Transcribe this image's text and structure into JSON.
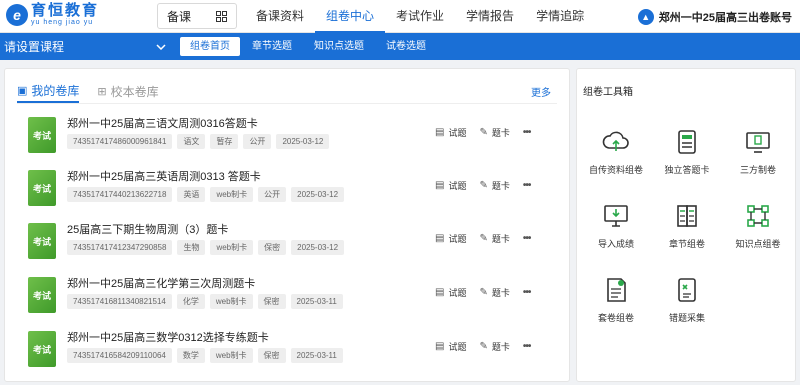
{
  "logo": {
    "cn": "育恒教育",
    "pinyin": "yu heng jiao yu"
  },
  "header": {
    "beike_label": "备课",
    "nav": [
      {
        "label": "备课资料"
      },
      {
        "label": "组卷中心"
      },
      {
        "label": "考试作业"
      },
      {
        "label": "学情报告"
      },
      {
        "label": "学情追踪"
      }
    ],
    "school": "郑州一中25届高三出卷账号"
  },
  "subbar": {
    "course_placeholder": "请设置课程",
    "tabs": [
      {
        "label": "组卷首页"
      },
      {
        "label": "章节选题"
      },
      {
        "label": "知识点选题"
      },
      {
        "label": "试卷选题"
      }
    ]
  },
  "library": {
    "tabs": [
      {
        "label": "我的卷库"
      },
      {
        "label": "校本卷库"
      }
    ],
    "more": "更多",
    "actions": {
      "quiz": "试题",
      "card": "题卡"
    },
    "items": [
      {
        "badge": "考试",
        "title": "郑州一中25届高三语文周测0316答题卡",
        "tags": [
          "743517417486000961841",
          "语文",
          "暂存",
          "公开",
          "2025-03-12"
        ]
      },
      {
        "badge": "考试",
        "title": "郑州一中25届高三英语周测0313 答题卡",
        "tags": [
          "743517417440213622718",
          "英语",
          "web制卡",
          "公开",
          "2025-03-12"
        ]
      },
      {
        "badge": "考试",
        "title": "25届高三下期生物周测（3）题卡",
        "tags": [
          "743517417412347290858",
          "生物",
          "web制卡",
          "保密",
          "2025-03-12"
        ]
      },
      {
        "badge": "考试",
        "title": "郑州一中25届高三化学第三次周测题卡",
        "tags": [
          "743517416811340821514",
          "化学",
          "web制卡",
          "保密",
          "2025-03-11"
        ]
      },
      {
        "badge": "考试",
        "title": "郑州一中25届高三数学0312选择专练题卡",
        "tags": [
          "743517416584209110064",
          "数学",
          "web制卡",
          "保密",
          "2025-03-11"
        ]
      }
    ]
  },
  "toolbox": {
    "title": "组卷工具箱",
    "tools": [
      {
        "label": "自传资料组卷",
        "icon": "cloud-upload-icon"
      },
      {
        "label": "独立答题卡",
        "icon": "answer-card-icon"
      },
      {
        "label": "三方制卷",
        "icon": "monitor-share-icon"
      },
      {
        "label": "导入成绩",
        "icon": "monitor-import-icon"
      },
      {
        "label": "章节组卷",
        "icon": "chapter-docs-icon"
      },
      {
        "label": "知识点组卷",
        "icon": "nodes-icon"
      },
      {
        "label": "套卷组卷",
        "icon": "paper-set-icon"
      },
      {
        "label": "错题采集",
        "icon": "error-collect-icon"
      }
    ]
  }
}
